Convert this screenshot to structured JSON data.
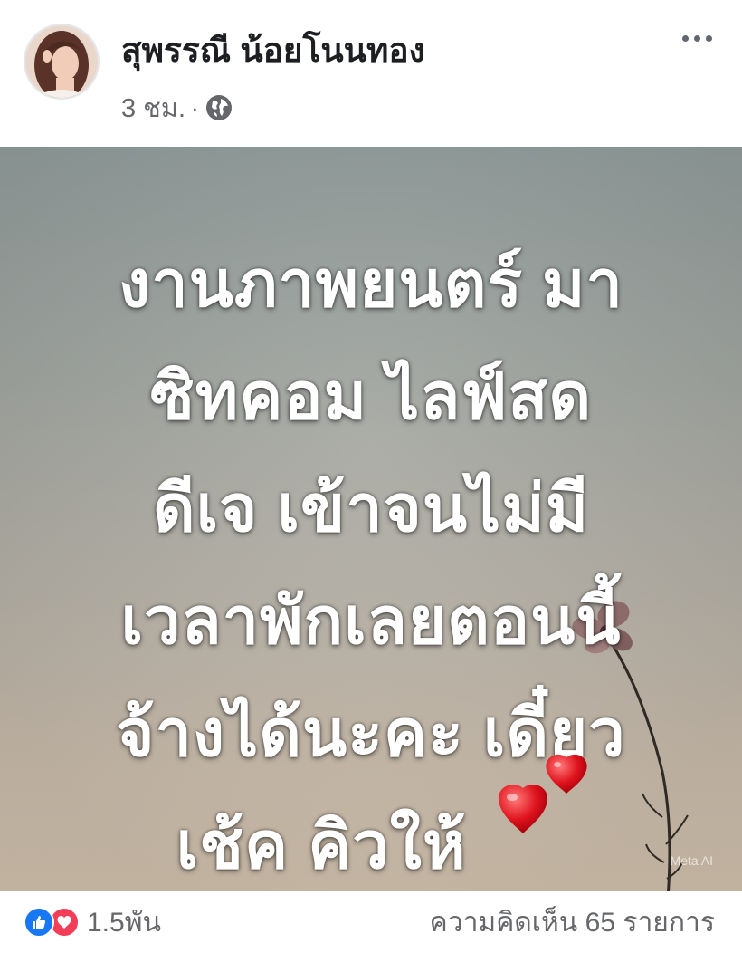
{
  "post": {
    "author": "สุพรรณี น้อยโนนทอง",
    "time": "3 ชม.",
    "separator": "·",
    "privacy_icon": "globe-icon",
    "more_icon": "more-options-icon"
  },
  "image": {
    "lines": [
      "งานภาพยนตร์ มา",
      "ซิทคอม ไลฟ์สด",
      "ดีเจ เข้าจนไม่มี",
      "เวลาพักเลยตอนนี้",
      "จ้างได้นะคะ เดี๋ยว",
      "เช้ค คิวให้"
    ],
    "emoji": "two-hearts",
    "watermark": "Meta AI",
    "text_color": "#ffffff"
  },
  "footer": {
    "reaction_icons": [
      "like-icon",
      "love-icon"
    ],
    "reaction_count": "1.5พัน",
    "comment_count": "ความคิดเห็น 65 รายการ"
  },
  "colors": {
    "like": "#1877f2",
    "love": "#f33e58",
    "secondary_text": "#65676b"
  }
}
